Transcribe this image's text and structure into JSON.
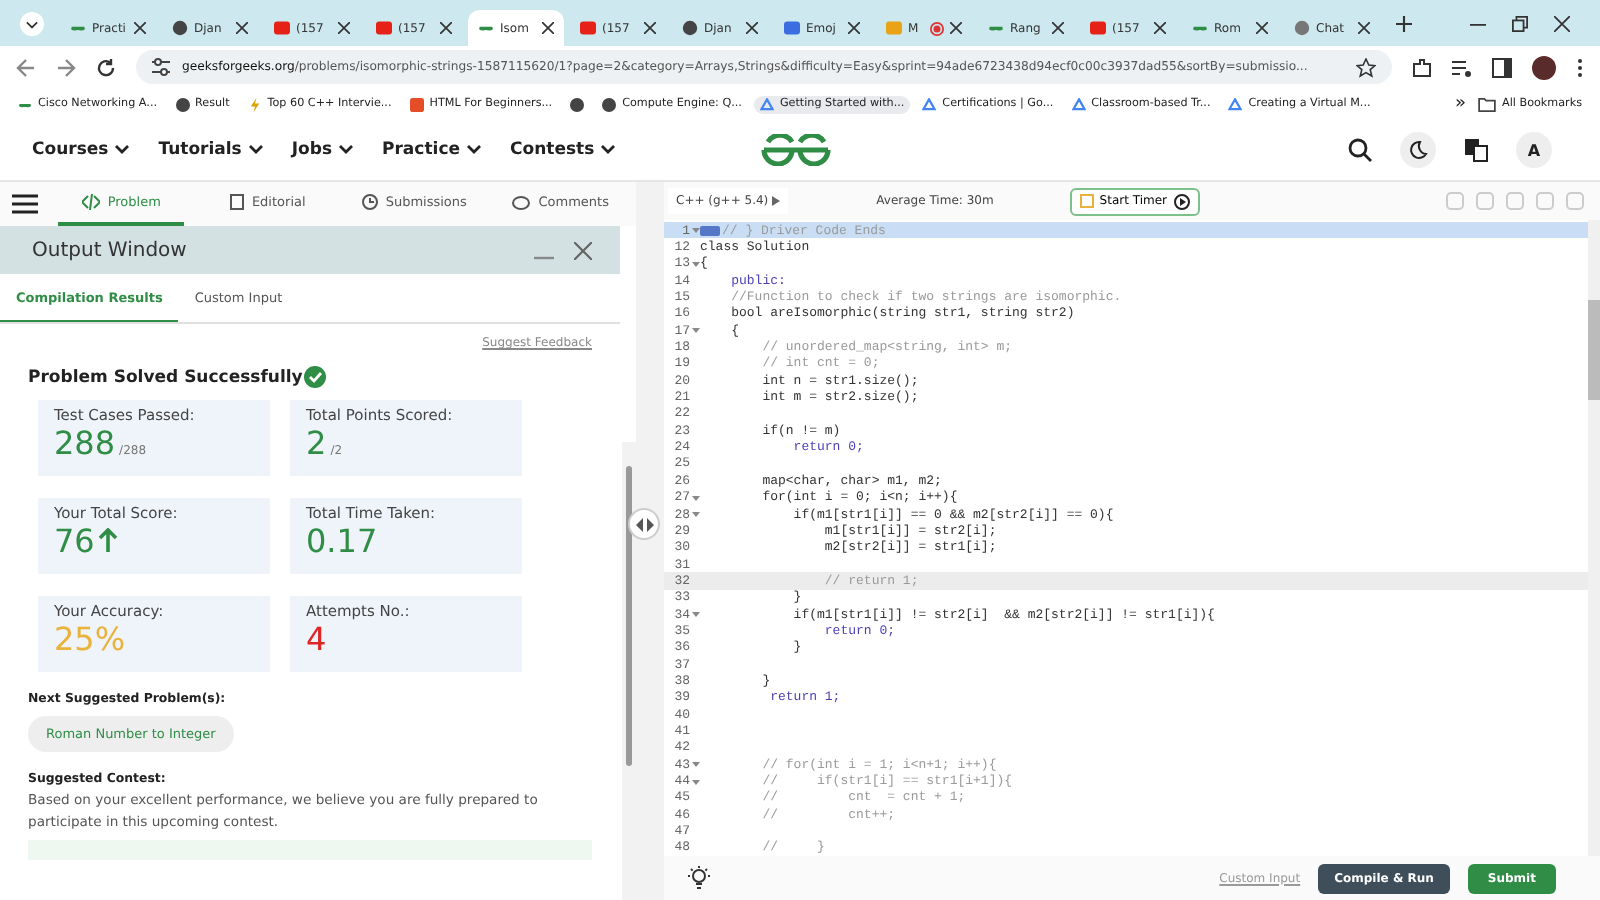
{
  "browser": {
    "tabs": [
      {
        "label": "Practi",
        "kind": "gfg",
        "selected": false
      },
      {
        "label": "Djan",
        "kind": "globe",
        "selected": false
      },
      {
        "label": "(157",
        "kind": "youtube",
        "selected": false
      },
      {
        "label": "(157",
        "kind": "youtube",
        "selected": false
      },
      {
        "label": "Isom",
        "kind": "gfg",
        "selected": true
      },
      {
        "label": "(157",
        "kind": "youtube",
        "selected": false
      },
      {
        "label": "Djan",
        "kind": "globe",
        "selected": false
      },
      {
        "label": "Emoj",
        "kind": "doc",
        "selected": false
      },
      {
        "label": "M",
        "kind": "meet",
        "selected": false
      },
      {
        "label": "Rang",
        "kind": "gfg",
        "selected": false
      },
      {
        "label": "(157",
        "kind": "youtube",
        "selected": false
      },
      {
        "label": "Rom",
        "kind": "gfg",
        "selected": false
      },
      {
        "label": "Chat",
        "kind": "chat",
        "selected": false
      }
    ],
    "url": {
      "domain": "geeksforgeeks.org",
      "path": "/problems/isomorphic-strings-1587115620/1?page=2&category=Arrays,Strings&difficulty=Easy&sprint=94ade6723438d94ecf0c00c3937dad55&sortBy=submissio..."
    },
    "bookmarks": [
      {
        "label": "Cisco Networking A...",
        "kind": "gfg"
      },
      {
        "label": "Result",
        "kind": "globe"
      },
      {
        "label": "Top 60 C++ Intervie...",
        "kind": "bolt"
      },
      {
        "label": "HTML For Beginners...",
        "kind": "h"
      },
      {
        "kind": "globe"
      },
      {
        "label": "Compute Engine: Q...",
        "kind": "globe"
      },
      {
        "label": "Getting Started with...",
        "kind": "cloud"
      },
      {
        "label": "Certifications  |  Go...",
        "kind": "cloud"
      },
      {
        "label": "Classroom-based Tr...",
        "kind": "cloud"
      },
      {
        "label": "Creating a Virtual M...",
        "kind": "cloud"
      }
    ],
    "more": "»",
    "all_bookmarks": "All Bookmarks"
  },
  "site_nav": {
    "menus": [
      "Courses",
      "Tutorials",
      "Jobs",
      "Practice",
      "Contests"
    ],
    "avatar": "A"
  },
  "problem_tabs": [
    {
      "label": "Problem",
      "kind": "code",
      "selected": true
    },
    {
      "label": "Editorial",
      "kind": "doc",
      "selected": false
    },
    {
      "label": "Submissions",
      "kind": "clock",
      "selected": false
    },
    {
      "label": "Comments",
      "kind": "chat",
      "selected": false
    }
  ],
  "output_window": {
    "title": "Output Window",
    "tabs": [
      {
        "label": "Compilation Results",
        "selected": true
      },
      {
        "label": "Custom Input",
        "selected": false
      }
    ],
    "suggest_feedback": "Suggest Feedback",
    "status": "Problem Solved Successfully",
    "stats": [
      {
        "label": "Test Cases Passed:",
        "value": "288",
        "suffix": "/288",
        "color": "#2f8d46",
        "rising": false
      },
      {
        "label": "Total Points Scored:",
        "value": "2",
        "suffix": "/2",
        "color": "#2f8d46",
        "rising": false
      },
      {
        "label": "Your Total Score:",
        "value": "76",
        "color": "#2f8d46",
        "rising": true
      },
      {
        "label": "Total Time Taken:",
        "value": "0.17",
        "color": "#2f8d46",
        "rising": false
      },
      {
        "label": "Your Accuracy:",
        "value": "25%",
        "color": "#e9b23b",
        "rising": false
      },
      {
        "label": "Attempts No.:",
        "value": "4",
        "color": "#e02424",
        "rising": false
      }
    ],
    "next_label": "Next Suggested Problem(s):",
    "next_problem": "Roman Number to Integer",
    "contest_label": "Suggested Contest:",
    "contest_text": "Based on your excellent performance, we believe you are fully prepared to participate in this upcoming contest."
  },
  "editor": {
    "language": "C++ (g++ 5.4)",
    "average_time": "Average Time: 30m",
    "start_timer": "Start Timer",
    "lines": [
      {
        "num": "1",
        "text": "// } Driver Code Ends",
        "kind": "comment",
        "fold": true,
        "folded": true,
        "current": false
      },
      {
        "num": "12",
        "text": "class Solution",
        "kind": "code",
        "fold": false,
        "folded": false,
        "current": false
      },
      {
        "num": "13",
        "text": "{",
        "kind": "code",
        "fold": true,
        "folded": false,
        "current": false
      },
      {
        "num": "14",
        "text": "    public:",
        "kind": "keyword",
        "fold": false,
        "folded": false,
        "current": false
      },
      {
        "num": "15",
        "text": "    //Function to check if two strings are isomorphic.",
        "kind": "comment",
        "fold": false,
        "folded": false,
        "current": false
      },
      {
        "num": "16",
        "text": "    bool areIsomorphic(string str1, string str2)",
        "kind": "code",
        "fold": false,
        "folded": false,
        "current": false
      },
      {
        "num": "17",
        "text": "    {",
        "kind": "code",
        "fold": true,
        "folded": false,
        "current": false
      },
      {
        "num": "18",
        "text": "        // unordered_map<string, int> m;",
        "kind": "comment",
        "fold": false,
        "folded": false,
        "current": false
      },
      {
        "num": "19",
        "text": "        // int cnt = 0;",
        "kind": "comment",
        "fold": false,
        "folded": false,
        "current": false
      },
      {
        "num": "20",
        "text": "        int n = str1.size();",
        "kind": "code",
        "fold": false,
        "folded": false,
        "current": false
      },
      {
        "num": "21",
        "text": "        int m = str2.size();",
        "kind": "code",
        "fold": false,
        "folded": false,
        "current": false
      },
      {
        "num": "22",
        "fold": false,
        "folded": false,
        "current": false
      },
      {
        "num": "23",
        "text": "        if(n != m)",
        "kind": "code",
        "fold": false,
        "folded": false,
        "current": false
      },
      {
        "num": "24",
        "text": "            return 0;",
        "kind": "keyword",
        "fold": false,
        "folded": false,
        "current": false
      },
      {
        "num": "25",
        "fold": false,
        "folded": false,
        "current": false
      },
      {
        "num": "26",
        "text": "        map<char, char> m1, m2;",
        "kind": "code",
        "fold": false,
        "folded": false,
        "current": false
      },
      {
        "num": "27",
        "text": "        for(int i = 0; i<n; i++){",
        "kind": "code",
        "fold": true,
        "folded": false,
        "current": false
      },
      {
        "num": "28",
        "text": "            if(m1[str1[i]] == 0 && m2[str2[i]] == 0){",
        "kind": "code",
        "fold": true,
        "folded": false,
        "current": false
      },
      {
        "num": "29",
        "text": "                m1[str1[i]] = str2[i];",
        "kind": "code",
        "fold": false,
        "folded": false,
        "current": false
      },
      {
        "num": "30",
        "text": "                m2[str2[i]] = str1[i];",
        "kind": "code",
        "fold": false,
        "folded": false,
        "current": false
      },
      {
        "num": "31",
        "fold": false,
        "folded": false,
        "current": false
      },
      {
        "num": "32",
        "text": "                // return 1;",
        "kind": "comment",
        "fold": false,
        "folded": false,
        "current": true
      },
      {
        "num": "33",
        "text": "            }",
        "kind": "code",
        "fold": false,
        "folded": false,
        "current": false
      },
      {
        "num": "34",
        "text": "            if(m1[str1[i]] != str2[i]  && m2[str2[i]] != str1[i]){",
        "kind": "code",
        "fold": true,
        "folded": false,
        "current": false
      },
      {
        "num": "35",
        "text": "                return 0;",
        "kind": "keyword",
        "fold": false,
        "folded": false,
        "current": false
      },
      {
        "num": "36",
        "text": "            }",
        "kind": "code",
        "fold": false,
        "folded": false,
        "current": false
      },
      {
        "num": "37",
        "fold": false,
        "folded": false,
        "current": false
      },
      {
        "num": "38",
        "text": "        }",
        "kind": "code",
        "fold": false,
        "folded": false,
        "current": false
      },
      {
        "num": "39",
        "text": "         return 1;",
        "kind": "keyword",
        "fold": false,
        "folded": false,
        "current": false
      },
      {
        "num": "40",
        "fold": false,
        "folded": false,
        "current": false
      },
      {
        "num": "41",
        "fold": false,
        "folded": false,
        "current": false
      },
      {
        "num": "42",
        "fold": false,
        "folded": false,
        "current": false
      },
      {
        "num": "43",
        "text": "        // for(int i = 1; i<n+1; i++){",
        "kind": "comment",
        "fold": true,
        "folded": false,
        "current": false
      },
      {
        "num": "44",
        "text": "        //     if(str1[i] == str1[i+1]){",
        "kind": "comment",
        "fold": true,
        "folded": false,
        "current": false
      },
      {
        "num": "45",
        "text": "        //         cnt  = cnt + 1;",
        "kind": "comment",
        "fold": false,
        "folded": false,
        "current": false
      },
      {
        "num": "46",
        "text": "        //         cnt++;",
        "kind": "comment",
        "fold": false,
        "folded": false,
        "current": false
      },
      {
        "num": "47",
        "fold": false,
        "folded": false,
        "current": false
      },
      {
        "num": "48",
        "text": "        //     }",
        "kind": "comment",
        "fold": false,
        "folded": false,
        "current": false
      }
    ],
    "custom_input": "Custom Input",
    "compile": "Compile & Run",
    "submit": "Submit"
  }
}
